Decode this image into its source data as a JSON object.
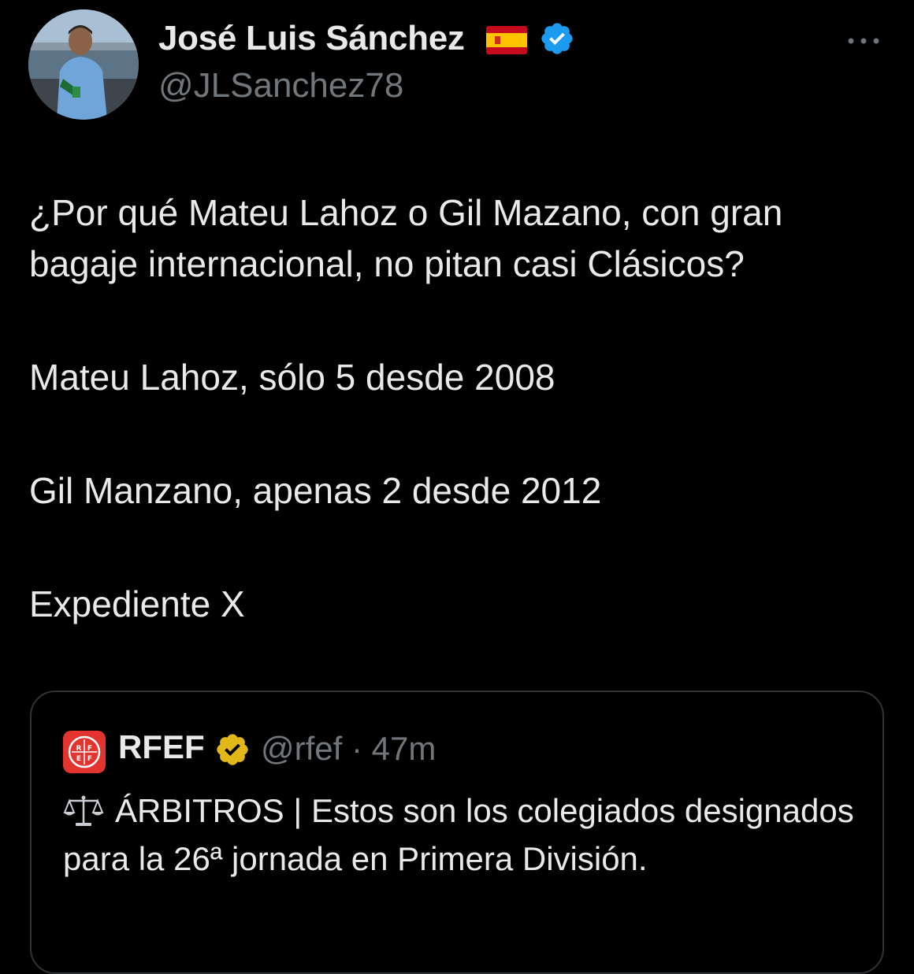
{
  "author": {
    "display_name": "José Luis Sánchez",
    "handle": "@JLSanchez78",
    "flag": "spain-flag-icon",
    "verified": "blue-verified-icon"
  },
  "tweet": {
    "paragraphs": [
      "¿Por qué Mateu Lahoz o Gil Mazano, con gran bagaje internacional, no pitan casi Clásicos?",
      "Mateu Lahoz, sólo 5 desde 2008",
      "Gil Manzano, apenas 2 desde 2012",
      "Expediente X"
    ]
  },
  "quote": {
    "name": "RFEF",
    "handle_time": "@rfef · 47m",
    "text": "ÁRBITROS | Estos son los colegiados designados para la 26ª jornada  en Primera División.",
    "logo": "rfef-logo-icon",
    "verified": "gold-verified-icon"
  },
  "colors": {
    "background": "#000000",
    "text": "#e7e9ea",
    "secondary": "#71767b",
    "border": "#2f3336",
    "verified_blue": "#1d9bf0",
    "verified_gold": "#e2b719",
    "rfef_red": "#e3342f"
  }
}
